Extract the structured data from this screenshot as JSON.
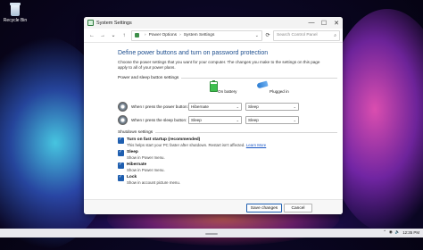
{
  "desktop": {
    "recycle_bin_label": "Recycle Bin"
  },
  "window": {
    "title": "System Settings",
    "controls": {
      "minimize": "—",
      "maximize": "☐",
      "close": "✕"
    }
  },
  "address_bar": {
    "back": "←",
    "forward": "→",
    "history": "⌄",
    "up": "↑",
    "crumbs": [
      "Power Options",
      "System Settings"
    ],
    "separator": "›",
    "dropdown": "⌄",
    "refresh": "⟳",
    "search_placeholder": "Search Control Panel",
    "search_icon": "⌕"
  },
  "main": {
    "heading": "Define power buttons and turn on password protection",
    "description": "Choose the power settings that you want for your computer. The changes you make to the settings on this page apply to all of your power plans.",
    "power_section_label": "Power and sleep button settings",
    "columns": {
      "on_battery": "On battery",
      "plugged_in": "Plugged in"
    },
    "rows": [
      {
        "label": "When I press the power button:",
        "on_battery": "Hibernate",
        "plugged_in": "Sleep"
      },
      {
        "label": "When I press the sleep button:",
        "on_battery": "Sleep",
        "plugged_in": "Sleep"
      }
    ],
    "shutdown_section_label": "Shutdown settings",
    "shutdown_options": [
      {
        "title": "Turn on fast startup (recommended)",
        "sub": "This helps start your PC faster after shutdown. Restart isn't affected.",
        "link": "Learn More",
        "checked": true
      },
      {
        "title": "Sleep",
        "sub": "Show in Power menu.",
        "checked": true
      },
      {
        "title": "Hibernate",
        "sub": "Show in Power menu.",
        "checked": true
      },
      {
        "title": "Lock",
        "sub": "Show in account picture menu.",
        "checked": true
      }
    ],
    "select_carat": "⌄"
  },
  "footer": {
    "save_label": "Save changes",
    "cancel_label": "Cancel"
  },
  "taskbar": {
    "tray_icons": [
      "⌃",
      "◉",
      "🔈"
    ],
    "time": "12:35 PM"
  }
}
